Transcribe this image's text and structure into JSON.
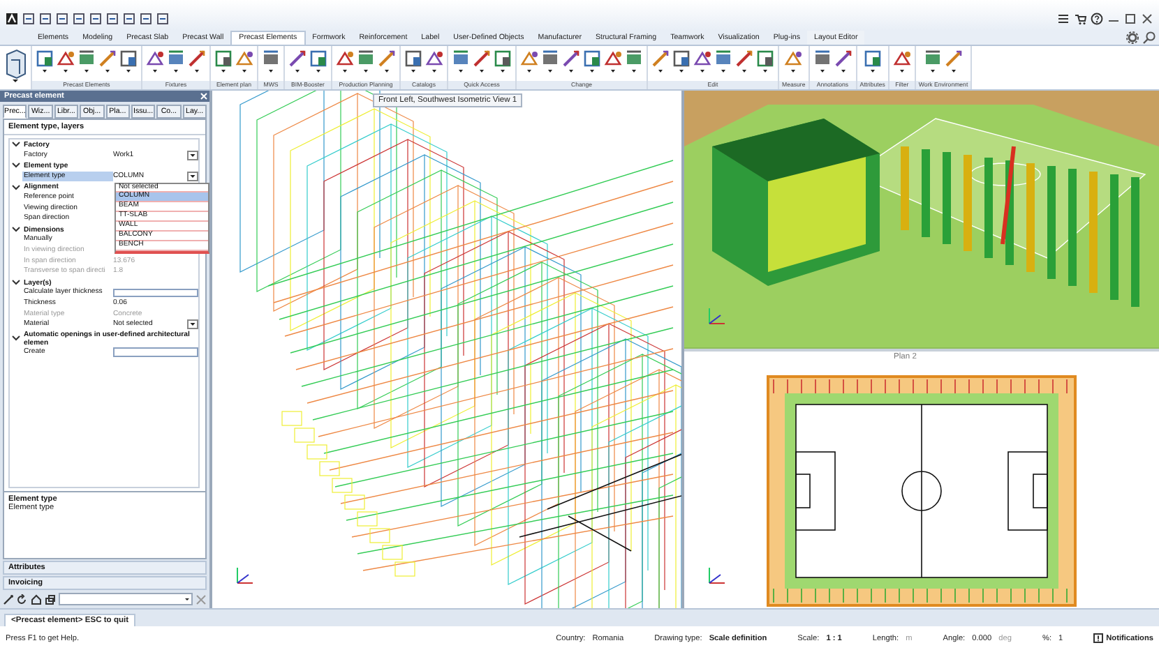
{
  "ribbon": {
    "tabs": [
      {
        "label": "Elements",
        "selected": false
      },
      {
        "label": "Modeling",
        "selected": false
      },
      {
        "label": "Precast Slab",
        "selected": false
      },
      {
        "label": "Precast Wall",
        "selected": false
      },
      {
        "label": "Precast Elements",
        "selected": true
      },
      {
        "label": "Formwork",
        "selected": false
      },
      {
        "label": "Reinforcement",
        "selected": false
      },
      {
        "label": "Label",
        "selected": false
      },
      {
        "label": "User-Defined Objects",
        "selected": false
      },
      {
        "label": "Manufacturer",
        "selected": false
      },
      {
        "label": "Structural Framing",
        "selected": false
      },
      {
        "label": "Teamwork",
        "selected": false
      },
      {
        "label": "Visualization",
        "selected": false
      },
      {
        "label": "Plug-ins",
        "selected": false
      },
      {
        "label": "Layout Editor",
        "selected": false
      }
    ],
    "groups": [
      {
        "label": "Precast Elements"
      },
      {
        "label": "Fixtures"
      },
      {
        "label": "Element plan"
      },
      {
        "label": "MWS"
      },
      {
        "label": "BIM-Booster"
      },
      {
        "label": "Production Planning"
      },
      {
        "label": "Catalogs"
      },
      {
        "label": "Quick Access"
      },
      {
        "label": "Change"
      },
      {
        "label": "Edit"
      },
      {
        "label": "Measure"
      },
      {
        "label": "Annotations"
      },
      {
        "label": "Attributes"
      },
      {
        "label": "Filter"
      },
      {
        "label": "Work Environment"
      }
    ]
  },
  "panel": {
    "title": "Precast element",
    "tabs": [
      {
        "label": "Prec...",
        "selected": true
      },
      {
        "label": "Wiz...",
        "selected": false
      },
      {
        "label": "Libr...",
        "selected": false
      },
      {
        "label": "Obj...",
        "selected": false
      },
      {
        "label": "Pla...",
        "selected": false
      },
      {
        "label": "Issu...",
        "selected": false
      },
      {
        "label": "Co...",
        "selected": false
      },
      {
        "label": "Lay...",
        "selected": false
      }
    ],
    "heading": "Element type, layers",
    "sections": [
      {
        "title": "Factory",
        "expanded": true,
        "rows": [
          {
            "label": "Factory",
            "value": "Work1",
            "kind": "dropdown",
            "disabled": false,
            "selected": false
          }
        ]
      },
      {
        "title": "Element type",
        "expanded": true,
        "rows": [
          {
            "label": "Element type",
            "value": "COLUMN",
            "kind": "dropdown",
            "disabled": false,
            "selected": true
          }
        ]
      },
      {
        "title": "Alignment",
        "expanded": true,
        "rows": [
          {
            "label": "Reference point",
            "kind": "text",
            "disabled": false,
            "selected": false
          },
          {
            "label": "Viewing direction",
            "kind": "text",
            "disabled": false,
            "selected": false
          },
          {
            "label": "Span direction",
            "kind": "text",
            "disabled": false,
            "selected": false
          }
        ]
      },
      {
        "title": "Dimensions",
        "expanded": true,
        "rows": [
          {
            "label": "Manually",
            "kind": "text",
            "disabled": false,
            "selected": false
          },
          {
            "label": "In viewing direction",
            "kind": "text",
            "disabled": true,
            "selected": false
          },
          {
            "label": "In span direction",
            "value": "13.676",
            "kind": "text",
            "disabled": true,
            "selected": false
          },
          {
            "label": "Transverse to span directi",
            "value": "1.8",
            "kind": "text",
            "disabled": true,
            "selected": false
          }
        ]
      },
      {
        "title": "Layer(s)",
        "expanded": true,
        "rows": [
          {
            "label": "Calculate layer thickness",
            "kind": "checkbox",
            "checked": false,
            "disabled": false,
            "selected": false
          },
          {
            "label": "Thickness",
            "value": "0.06",
            "kind": "text",
            "disabled": false,
            "selected": false
          },
          {
            "label": "Material type",
            "value": "Concrete",
            "kind": "text",
            "disabled": true,
            "selected": false
          },
          {
            "label": "Material",
            "value": "Not selected",
            "kind": "dropdown",
            "disabled": false,
            "selected": false
          }
        ]
      },
      {
        "title": "Automatic openings in user-defined architectural elemen",
        "expanded": true,
        "rows": [
          {
            "label": "Create",
            "kind": "checkbox",
            "checked": false,
            "disabled": false,
            "selected": false
          }
        ]
      }
    ],
    "dropdown_list": [
      {
        "label": "Not selected",
        "selected": false
      },
      {
        "label": "COLUMN",
        "selected": true
      },
      {
        "label": "BEAM",
        "selected": false
      },
      {
        "label": "TT-SLAB",
        "selected": false
      },
      {
        "label": "WALL",
        "selected": false
      },
      {
        "label": "BALCONY",
        "selected": false
      },
      {
        "label": "BENCH",
        "selected": false
      }
    ],
    "description": {
      "title": "Element type",
      "text": "Element type"
    },
    "bars": [
      "Attributes",
      "Invoicing"
    ]
  },
  "viewports": [
    {
      "kind": "wireframe",
      "title": "Front Left, Southwest Isometric View 1"
    },
    {
      "kind": "render"
    },
    {
      "kind": "plan",
      "title": "Plan 2"
    }
  ],
  "command_tab": "<Precast element> ESC to quit",
  "status_bar": {
    "help": "Press F1 to get Help.",
    "fields": [
      {
        "label": "Country:",
        "value": "Romania",
        "bold": false
      },
      {
        "label": "Drawing type:",
        "value": "Scale definition",
        "bold": true
      },
      {
        "label": "Scale:",
        "value": "1 : 1",
        "bold": true
      },
      {
        "label": "Length:",
        "unit": "m"
      },
      {
        "label": "Angle:",
        "value": "0.000",
        "unit": "deg"
      },
      {
        "label": "%:",
        "value": "1"
      }
    ],
    "notifications": "Notifications"
  }
}
